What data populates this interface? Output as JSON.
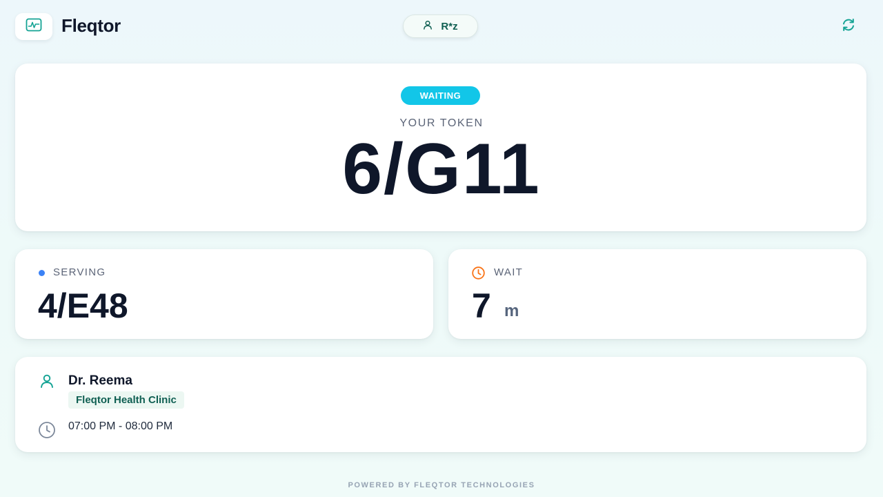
{
  "header": {
    "app_name": "Fleqtor",
    "logo_icon": "activity-monitor-icon",
    "user_label": "R*z",
    "user_icon": "user-icon",
    "refresh_icon": "refresh-icon"
  },
  "token": {
    "status": "WAITING",
    "label": "YOUR TOKEN",
    "value": "6/G11"
  },
  "serving": {
    "label": "SERVING",
    "value": "4/E48"
  },
  "wait": {
    "label": "WAIT",
    "value": "7",
    "unit": "m"
  },
  "doctor": {
    "name": "Dr. Reema",
    "clinic": "Fleqtor Health Clinic",
    "hours": "07:00 PM - 08:00 PM"
  },
  "footer": {
    "text": "POWERED BY FLEQTOR TECHNOLOGIES"
  },
  "colors": {
    "brand_green": "#0f5f52",
    "accent_teal": "#14a394",
    "status_cyan": "#12c6e8",
    "serving_blue": "#3b82f6",
    "wait_orange": "#f97316",
    "text_dark": "#0f172a"
  }
}
